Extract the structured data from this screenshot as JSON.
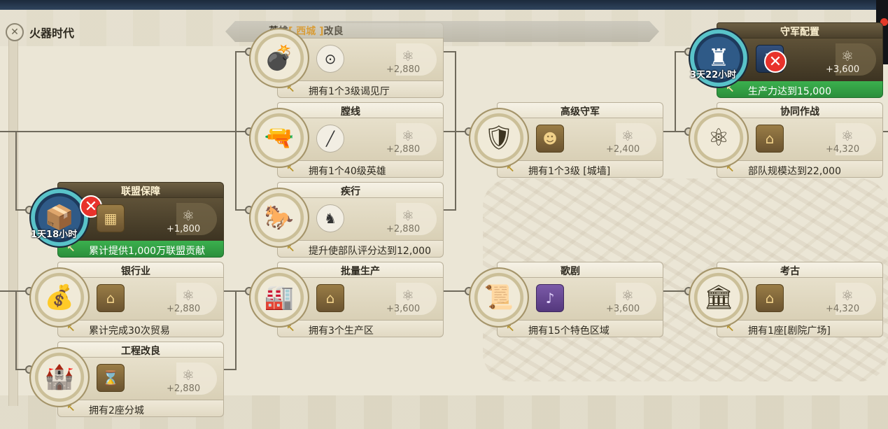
{
  "era": {
    "label": "火器时代",
    "icon": "crossed-swords-icon"
  },
  "banner": {
    "prefix": "英雄",
    "tag": "[ 西城 ]",
    "suffix": "改良"
  },
  "cards": {
    "alliance": {
      "title": "联盟保障",
      "timer": "1天18小时",
      "value": "+1,800",
      "requirement": "累计提供1,000万联盟贡献",
      "medallion_icon": "supplies-icon",
      "bonus_icon": "crate-icon"
    },
    "banking": {
      "title": "银行业",
      "value": "+2,880",
      "requirement": "累计完成30次贸易",
      "medallion_icon": "money-icon",
      "bonus_icon": "market-icon"
    },
    "engineering": {
      "title": "工程改良",
      "value": "+2,880",
      "requirement": "拥有2座分城",
      "medallion_icon": "castle-icon",
      "bonus_icon": "hourglass-icon"
    },
    "cannon": {
      "title": "",
      "value": "+2,880",
      "requirement": "拥有1个3级谒见厅",
      "medallion_icon": "cannon-icon",
      "bonus_icon": "cannon-icon"
    },
    "rifling": {
      "title": "膛线",
      "value": "+2,880",
      "requirement": "拥有1个40级英雄",
      "medallion_icon": "rifle-icon",
      "bonus_icon": "rifle-icon"
    },
    "march": {
      "title": "疾行",
      "value": "+2,880",
      "requirement": "提升使部队评分达到12,000",
      "medallion_icon": "horse-icon",
      "bonus_icon": "horse-icon"
    },
    "mass": {
      "title": "批量生产",
      "value": "+3,600",
      "requirement": "拥有3个生产区",
      "medallion_icon": "factory-icon",
      "bonus_icon": "factory-icon"
    },
    "guard": {
      "title": "高级守军",
      "value": "+2,400",
      "requirement": "拥有1个3级 [城墙]",
      "medallion_icon": "soldiers-icon",
      "bonus_icon": "soldier-icon"
    },
    "opera": {
      "title": "歌剧",
      "value": "+3,600",
      "requirement": "拥有15个特色区域",
      "medallion_icon": "scroll-icon",
      "bonus_icon": "music-icon"
    },
    "garrison": {
      "title": "守军配置",
      "timer": "3天22小时",
      "value": "+3,600",
      "requirement": "生产力达到15,000",
      "medallion_icon": "tower-icon",
      "bonus_icon": "tower-icon"
    },
    "coop": {
      "title": "协同作战",
      "value": "+4,320",
      "requirement": "部队规模达到22,000",
      "medallion_icon": "atom-icon",
      "bonus_icon": "pavilion-icon"
    },
    "archaeology": {
      "title": "考古",
      "value": "+4,320",
      "requirement": "拥有1座[剧院广场]",
      "medallion_icon": "ruins-icon",
      "bonus_icon": "pavilion-icon"
    }
  }
}
